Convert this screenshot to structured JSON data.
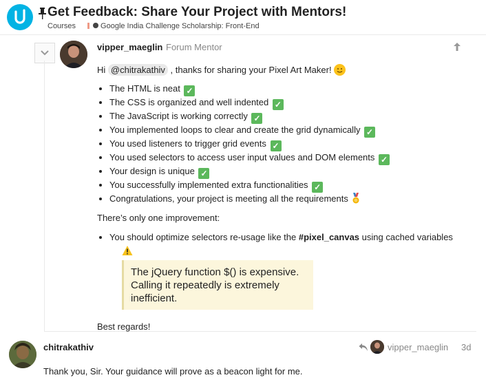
{
  "header": {
    "title": "Get Feedback: Share Your Project with Mentors!",
    "breadcrumbs": [
      "Courses",
      "Google India Challenge Scholarship: Front-End"
    ],
    "colors": {
      "logo": "#02b3e4",
      "crumb_bar": "#e45735"
    }
  },
  "post1": {
    "username": "vipper_maeglin",
    "user_title": "Forum Mentor",
    "greeting_pre": "Hi",
    "mention": "@chitrakathiv",
    "greeting_post": ", thanks for sharing your Pixel Art Maker!",
    "checklist": [
      "The HTML is neat",
      "The CSS is organized and well indented",
      "The JavaScript is working correctly",
      "You implemented loops to clear and create the grid dynamically",
      "You used listeners to trigger grid events",
      "You used selectors to access user input values and DOM elements",
      "Your design is unique",
      "You successfully implemented extra functionalities",
      "Congratulations, your project is meeting all the requirements"
    ],
    "improvement_intro": "There’s only one improvement:",
    "improvement_pre": "You should optimize selectors re-usage like the",
    "improvement_code": "#pixel_canvas",
    "improvement_post": "using cached variables",
    "quote": "The jQuery function $() is expensive. Calling it repeatedly is extremely inefficient.",
    "closing": "Best regards!"
  },
  "post2": {
    "username": "chitrakathiv",
    "reply_to": "vipper_maeglin",
    "age": "3d",
    "text": "Thank you, Sir. Your guidance will prove as a beacon light for me."
  }
}
